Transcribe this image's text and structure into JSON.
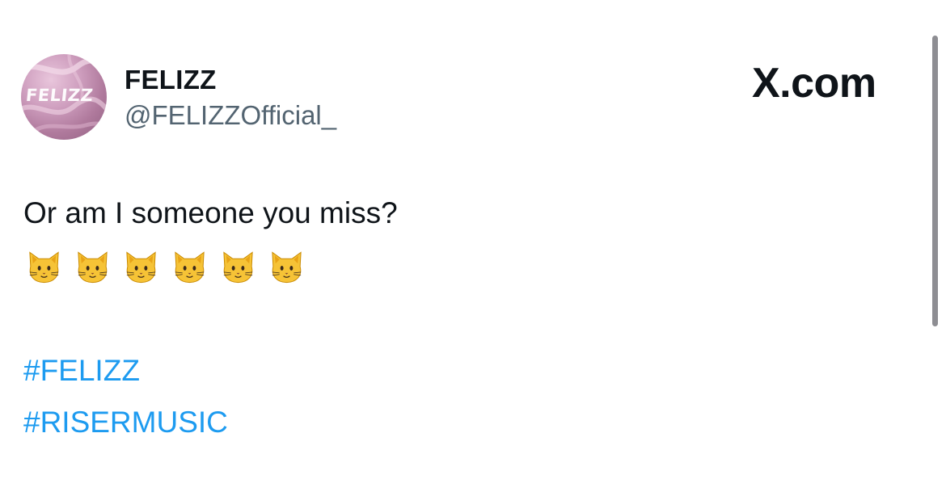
{
  "author": {
    "avatar_text": "FELIZZ",
    "display_name": "FELIZZ",
    "handle": "@FELIZZOfficial_"
  },
  "brand": {
    "label": "X.com"
  },
  "tweet": {
    "text": "Or am I someone you miss?",
    "emojis": [
      "cat-face-icon",
      "cat-face-icon",
      "cat-face-icon",
      "cat-face-icon",
      "cat-face-icon",
      "cat-face-icon"
    ],
    "hashtags": [
      "#FELIZZ",
      "#RISERMUSIC"
    ]
  },
  "colors": {
    "text": "#0f1419",
    "secondary": "#536471",
    "link": "#1d9bf0",
    "background": "#ffffff"
  }
}
